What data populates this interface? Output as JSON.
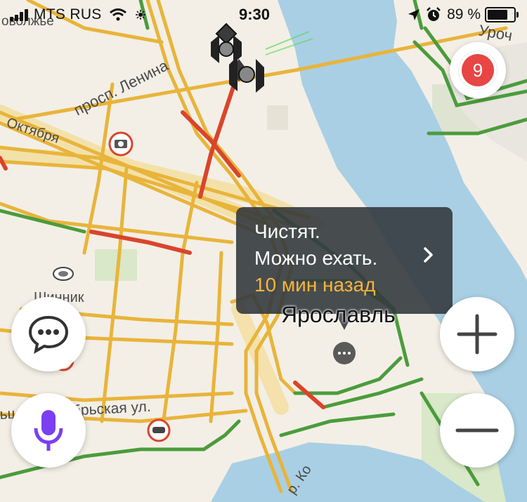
{
  "status_bar": {
    "carrier": "MTS RUS",
    "time": "9:30",
    "battery_percent": "89 %",
    "battery_level": 0.89
  },
  "map": {
    "labels": {
      "top_left_area": "оволжье",
      "street_lenina": "просп. Ленина",
      "street_oktyabrya": "Октября",
      "stadium": "Шинник",
      "street_bolshaya": "ьшая Октябрьская ул.",
      "top_right_area": "Уроч",
      "river": "р. Ко"
    },
    "city": "Ярославль"
  },
  "popup": {
    "line1": "Чистят.",
    "line2": "Можно ехать.",
    "line3": "10 мин назад"
  },
  "traffic": {
    "level": "9"
  },
  "colors": {
    "road_yellow": "#e8b43a",
    "road_green": "#4b9c3c",
    "road_red": "#d9452b",
    "water": "#a9cfe4",
    "accent_orange": "#f6b43a",
    "mic_purple": "#7a3ff0"
  }
}
